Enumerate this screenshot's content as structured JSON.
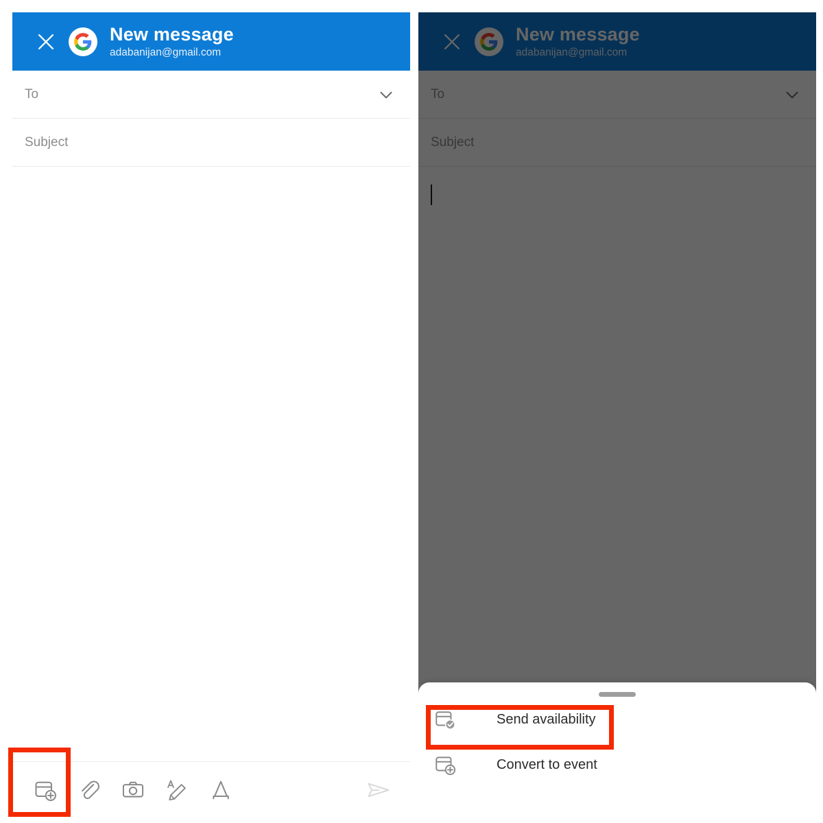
{
  "app": {
    "header": {
      "title": "New message",
      "account_email": "adabanijan@gmail.com",
      "close_icon": "close-icon",
      "avatar_icon": "google-g-avatar-icon",
      "background_color": "#0d7cd6"
    },
    "fields": {
      "to_label": "To",
      "to_value": "",
      "expand_icon": "chevron-down-icon",
      "subject_label": "Subject",
      "subject_value": "",
      "body_value": ""
    },
    "toolbar": {
      "items": [
        {
          "name": "calendar-add-icon",
          "label": "Insert from Calendar"
        },
        {
          "name": "paperclip-icon",
          "label": "Attach file"
        },
        {
          "name": "camera-icon",
          "label": "Take photo"
        },
        {
          "name": "markup-pen-icon",
          "label": "Markup"
        },
        {
          "name": "format-text-icon",
          "label": "Formatting options"
        }
      ],
      "send_icon": "send-icon",
      "send_label": "Send"
    }
  },
  "bottom_sheet": {
    "handle": "drag-handle",
    "items": [
      {
        "icon": "calendar-check-icon",
        "label": "Send availability"
      },
      {
        "icon": "calendar-add-icon",
        "label": "Convert to event"
      }
    ]
  },
  "annotations": {
    "highlight_color": "#f42a00",
    "boxes": [
      {
        "target": "calendar-add-toolbar-button"
      },
      {
        "target": "send-availability-menu-item"
      }
    ]
  },
  "scrim": {
    "color": "#000000",
    "opacity": "0.60"
  }
}
